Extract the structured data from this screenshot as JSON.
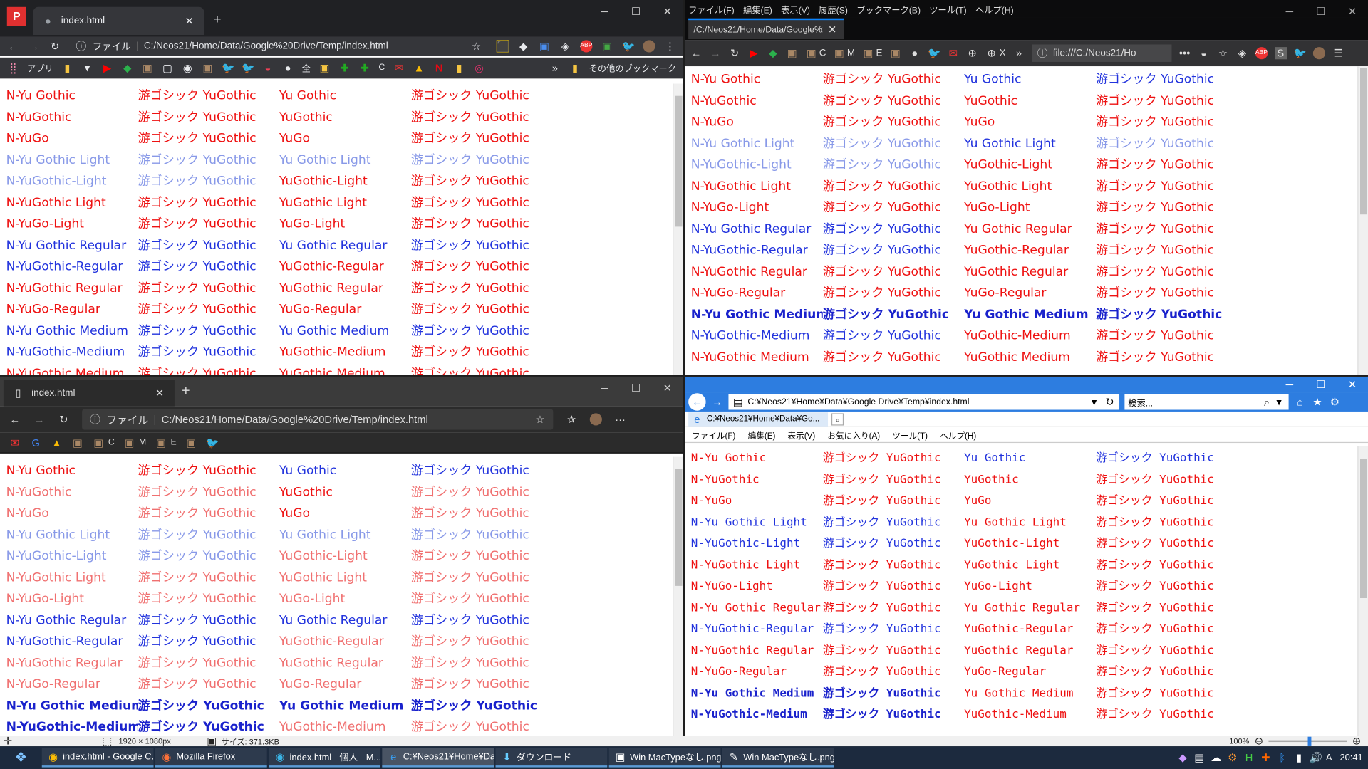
{
  "chrome": {
    "tab_title": "index.html",
    "address_prefix": "ファイル",
    "address": "C:/Neos21/Home/Data/Google%20Drive/Temp/index.html",
    "bookmarks": [
      {
        "label": "アプリ",
        "icon": "apps-icon"
      },
      {
        "label": "全",
        "icon": "globe-icon"
      },
      {
        "label": "C",
        "icon": "green-c-icon"
      }
    ],
    "other_bookmarks": "その他のブックマーク"
  },
  "firefox": {
    "menu": [
      "ファイル(F)",
      "編集(E)",
      "表示(V)",
      "履歴(S)",
      "ブックマーク(B)",
      "ツール(T)",
      "ヘルプ(H)"
    ],
    "tab_title": "/C:/Neos21/Home/Data/Google%2",
    "bm_labels": [
      "C",
      "M",
      "E",
      "X"
    ],
    "address": "file:///C:/Neos21/Ho"
  },
  "edge": {
    "tab_title": "index.html",
    "address_prefix": "ファイル",
    "address": "C:/Neos21/Home/Data/Google%20Drive/Temp/index.html",
    "bm_labels": [
      "C",
      "M",
      "E"
    ]
  },
  "ie": {
    "address": "C:¥Neos21¥Home¥Data¥Google Drive¥Temp¥index.html",
    "search_placeholder": "検索...",
    "tab_title": "C:¥Neos21¥Home¥Data¥Go...",
    "menu": [
      "ファイル(F)",
      "編集(E)",
      "表示(V)",
      "お気に入り(A)",
      "ツール(T)",
      "ヘルプ(H)"
    ],
    "zoom": "100%"
  },
  "status": {
    "dimensions": "1920 × 1080px",
    "size": "サイズ: 371.3KB"
  },
  "taskbar": {
    "items": [
      "index.html - Google C...",
      "Mozilla Firefox",
      "index.html - 個人 - M...",
      "C:¥Neos21¥Home¥Da...",
      "ダウンロード",
      "Win MacTypeなし.png...",
      "Win MacTypeなし.png..."
    ],
    "time": "20:41",
    "ime": "A"
  },
  "font_rows": [
    [
      "N-Yu Gothic",
      "游ゴシック YuGothic",
      "Yu Gothic",
      "游ゴシック YuGothic"
    ],
    [
      "N-YuGothic",
      "游ゴシック YuGothic",
      "YuGothic",
      "游ゴシック YuGothic"
    ],
    [
      "N-YuGo",
      "游ゴシック YuGothic",
      "YuGo",
      "游ゴシック YuGothic"
    ],
    [
      "N-Yu Gothic Light",
      "游ゴシック YuGothic",
      "Yu Gothic Light",
      "游ゴシック YuGothic"
    ],
    [
      "N-YuGothic-Light",
      "游ゴシック YuGothic",
      "YuGothic-Light",
      "游ゴシック YuGothic"
    ],
    [
      "N-YuGothic Light",
      "游ゴシック YuGothic",
      "YuGothic Light",
      "游ゴシック YuGothic"
    ],
    [
      "N-YuGo-Light",
      "游ゴシック YuGothic",
      "YuGo-Light",
      "游ゴシック YuGothic"
    ],
    [
      "N-Yu Gothic Regular",
      "游ゴシック YuGothic",
      "Yu Gothic Regular",
      "游ゴシック YuGothic"
    ],
    [
      "N-YuGothic-Regular",
      "游ゴシック YuGothic",
      "YuGothic-Regular",
      "游ゴシック YuGothic"
    ],
    [
      "N-YuGothic Regular",
      "游ゴシック YuGothic",
      "YuGothic Regular",
      "游ゴシック YuGothic"
    ],
    [
      "N-YuGo-Regular",
      "游ゴシック YuGothic",
      "YuGo-Regular",
      "游ゴシック YuGothic"
    ],
    [
      "N-Yu Gothic Medium",
      "游ゴシック YuGothic",
      "Yu Gothic Medium",
      "游ゴシック YuGothic"
    ],
    [
      "N-YuGothic-Medium",
      "游ゴシック YuGothic",
      "YuGothic-Medium",
      "游ゴシック YuGothic"
    ],
    [
      "N-YuGothic Medium",
      "游ゴシック YuGothic",
      "YuGothic Medium",
      "游ゴシック YuGothic"
    ]
  ],
  "grids": {
    "chrome": [
      "rrrr",
      "rrrr",
      "rrrr",
      "llll",
      "llrr",
      "rrrr",
      "rrrr",
      "bbbb",
      "bbrr",
      "rrrr",
      "rrrr",
      "bbbb",
      "bbrr",
      "rrrr"
    ],
    "firefox": [
      "rrbb",
      "rrrr",
      "rrrr",
      "llbl",
      "llrr",
      "rrrr",
      "rrrr",
      "bbrr",
      "bbrr",
      "rrrr",
      "rrrr",
      "kkkk",
      "bbrr",
      "rrrr"
    ],
    "edge": [
      "rrbb",
      "ssrs",
      "ssrs",
      "llll",
      "llss",
      "ssss",
      "ssss",
      "bbbb",
      "bbss",
      "ssss",
      "ssss",
      "kkkk",
      "kkss",
      "ssss"
    ],
    "ie": [
      "rrbb",
      "rrrr",
      "rrrr",
      "bbrr",
      "bbrr",
      "rrrr",
      "rrrr",
      "rrrr",
      "bbrr",
      "rrrr",
      "rrrr",
      "kkrr",
      "kkrr",
      "rrrr"
    ]
  },
  "colors": {
    "red": "#ee1111",
    "blue": "#2233dd",
    "light": "#8899e8",
    "lightred": "#f07070",
    "bold": "#1a22cc"
  }
}
